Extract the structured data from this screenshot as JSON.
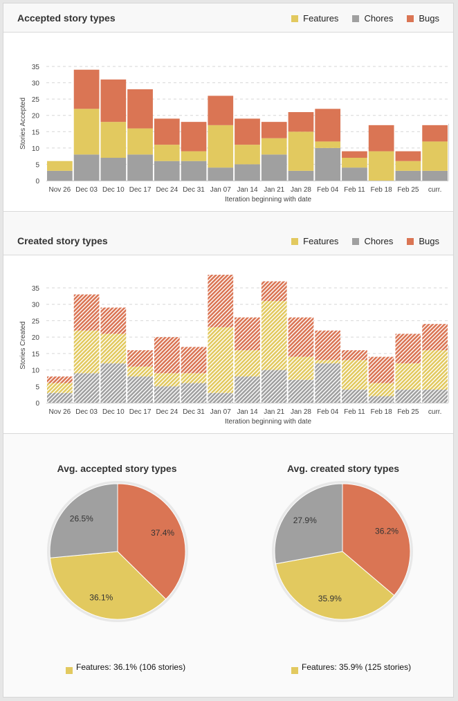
{
  "colors": {
    "features": "#e2c95f",
    "chores": "#a0a0a0",
    "bugs": "#da7554",
    "grid": "#d6d6d6",
    "axis_text": "#444444"
  },
  "legend": [
    {
      "key": "features",
      "label": "Features"
    },
    {
      "key": "chores",
      "label": "Chores"
    },
    {
      "key": "bugs",
      "label": "Bugs"
    }
  ],
  "chart_data": [
    {
      "id": "accepted",
      "type": "bar",
      "stacked": true,
      "hatched": false,
      "title": "Accepted story types",
      "xlabel": "Iteration beginning with date",
      "ylabel": "Stories Accepted",
      "ylim": [
        0,
        35
      ],
      "yticks": [
        0,
        5,
        10,
        15,
        20,
        25,
        30,
        35
      ],
      "grid": true,
      "legend_position": "top-right",
      "categories": [
        "Nov 26",
        "Dec 03",
        "Dec 10",
        "Dec 17",
        "Dec 24",
        "Dec 31",
        "Jan 07",
        "Jan 14",
        "Jan 21",
        "Jan 28",
        "Feb 04",
        "Feb 11",
        "Feb 18",
        "Feb 25",
        "curr."
      ],
      "series": [
        {
          "name": "Chores",
          "key": "chores",
          "values": [
            3,
            8,
            7,
            8,
            6,
            6,
            4,
            5,
            8,
            3,
            10,
            4,
            0,
            3,
            3
          ]
        },
        {
          "name": "Features",
          "key": "features",
          "values": [
            3,
            14,
            11,
            8,
            5,
            3,
            13,
            6,
            5,
            12,
            2,
            3,
            9,
            3,
            9
          ]
        },
        {
          "name": "Bugs",
          "key": "bugs",
          "values": [
            0,
            12,
            13,
            12,
            8,
            9,
            9,
            8,
            5,
            6,
            10,
            2,
            8,
            3,
            5
          ]
        }
      ]
    },
    {
      "id": "created",
      "type": "bar",
      "stacked": true,
      "hatched": true,
      "title": "Created story types",
      "xlabel": "Iteration beginning with date",
      "ylabel": "Stories Created",
      "ylim": [
        0,
        35
      ],
      "yticks": [
        0,
        5,
        10,
        15,
        20,
        25,
        30,
        35
      ],
      "grid": true,
      "legend_position": "top-right",
      "categories": [
        "Nov 26",
        "Dec 03",
        "Dec 10",
        "Dec 17",
        "Dec 24",
        "Dec 31",
        "Jan 07",
        "Jan 14",
        "Jan 21",
        "Jan 28",
        "Feb 04",
        "Feb 11",
        "Feb 18",
        "Feb 25",
        "curr."
      ],
      "series": [
        {
          "name": "Chores",
          "key": "chores",
          "values": [
            3,
            9,
            12,
            8,
            5,
            6,
            3,
            8,
            10,
            7,
            12,
            4,
            2,
            4,
            4
          ]
        },
        {
          "name": "Features",
          "key": "features",
          "values": [
            3,
            13,
            9,
            3,
            4,
            3,
            20,
            8,
            21,
            7,
            1,
            9,
            4,
            8,
            12
          ]
        },
        {
          "name": "Bugs",
          "key": "bugs",
          "values": [
            2,
            11,
            8,
            5,
            11,
            8,
            16,
            10,
            6,
            12,
            9,
            3,
            8,
            9,
            8
          ]
        }
      ]
    },
    {
      "id": "avg-accepted",
      "type": "pie",
      "title": "Avg. accepted story types",
      "slices": [
        {
          "name": "Bugs",
          "key": "bugs",
          "value": 37.4,
          "label": "37.4%"
        },
        {
          "name": "Features",
          "key": "features",
          "value": 36.1,
          "label": "36.1%"
        },
        {
          "name": "Chores",
          "key": "chores",
          "value": 26.5,
          "label": "26.5%"
        }
      ],
      "legend_text": "Features: 36.1% (106 stories)",
      "legend_key": "features"
    },
    {
      "id": "avg-created",
      "type": "pie",
      "title": "Avg. created story types",
      "slices": [
        {
          "name": "Bugs",
          "key": "bugs",
          "value": 36.2,
          "label": "36.2%"
        },
        {
          "name": "Features",
          "key": "features",
          "value": 35.9,
          "label": "35.9%"
        },
        {
          "name": "Chores",
          "key": "chores",
          "value": 27.9,
          "label": "27.9%"
        }
      ],
      "legend_text": "Features: 35.9% (125 stories)",
      "legend_key": "features"
    }
  ]
}
